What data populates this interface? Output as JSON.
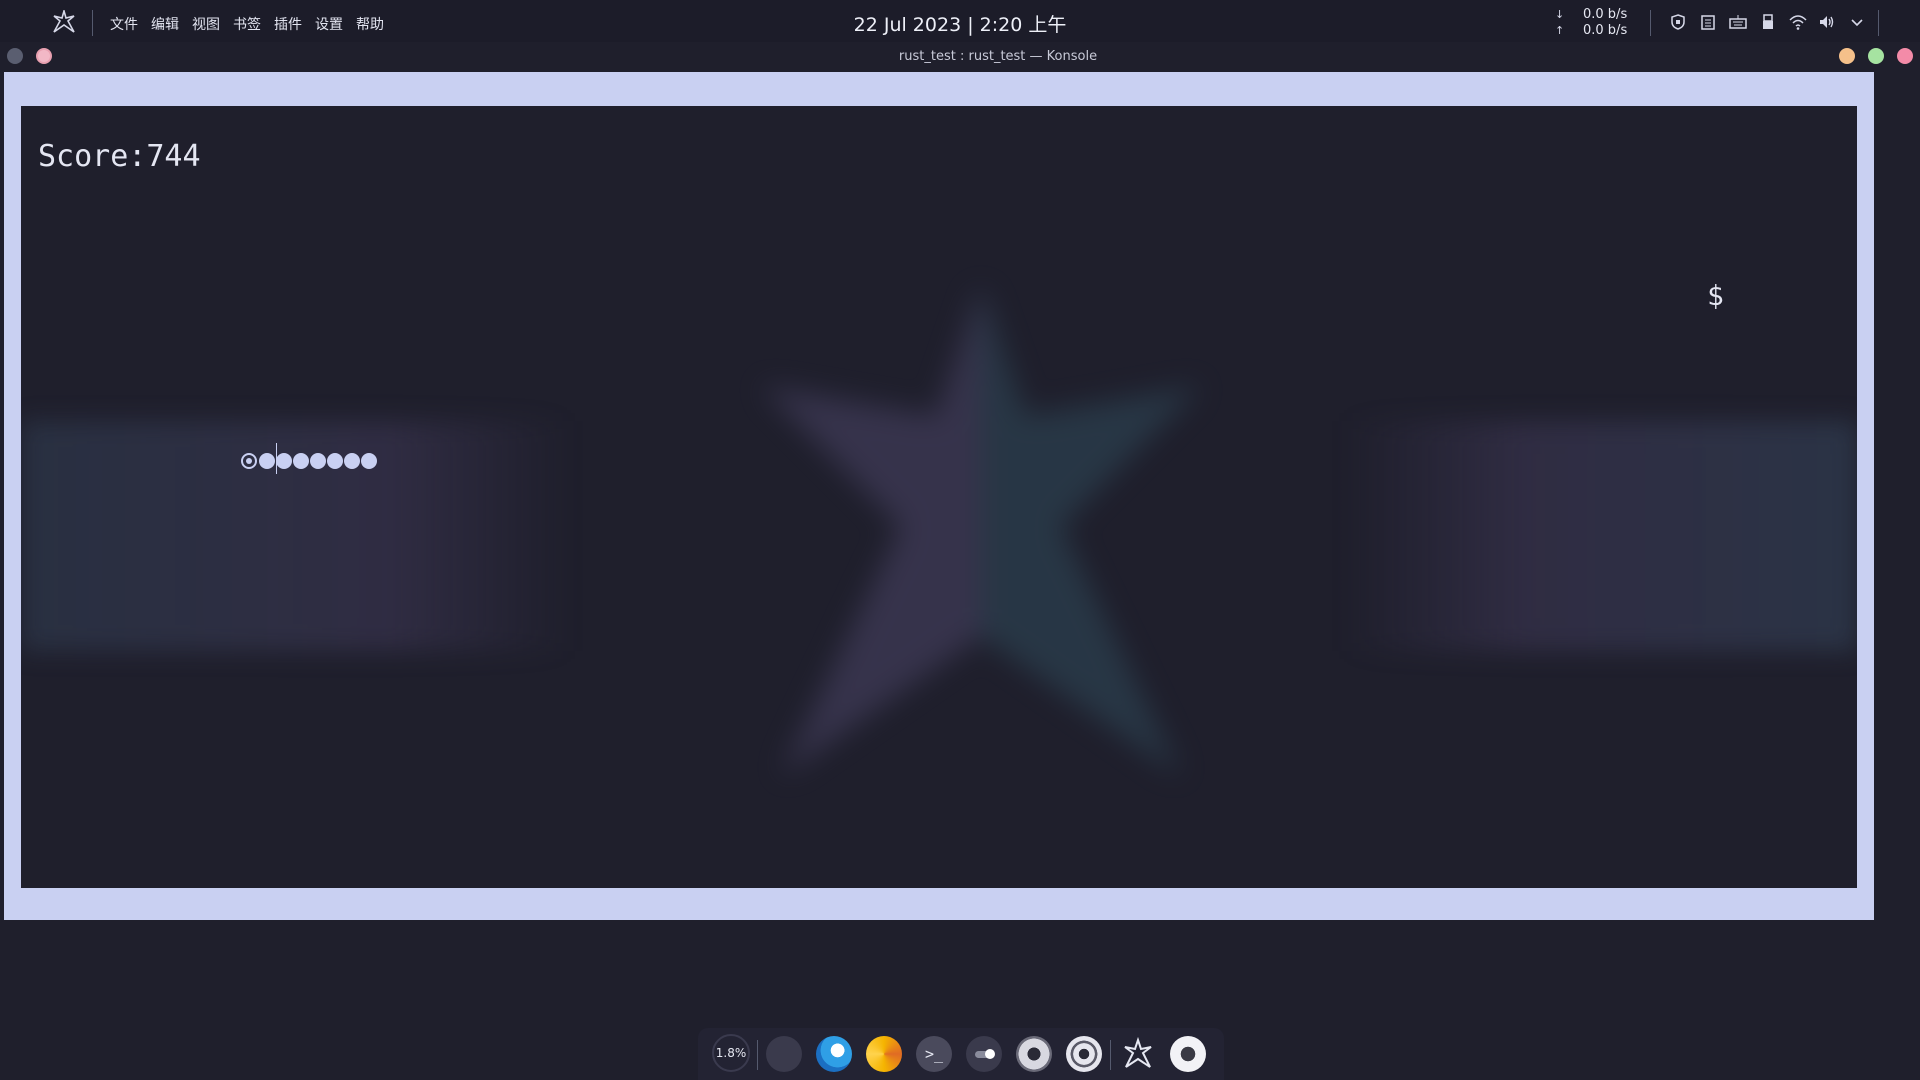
{
  "panel": {
    "menus": [
      "文件",
      "编辑",
      "视图",
      "书签",
      "插件",
      "设置",
      "帮助"
    ],
    "clock": "22 Jul 2023 | 2:20 上午",
    "net_down_arrow": "↓",
    "net_down": "0.0 b/s",
    "net_up_arrow": "↑",
    "net_up": "0.0 b/s",
    "tray_icons": [
      "security-icon",
      "clipboard-icon",
      "keyboard-icon",
      "usb-device-icon",
      "wifi-icon",
      "volume-icon",
      "chevron-down-icon"
    ]
  },
  "window": {
    "title": "rust_test : rust_test — Konsole"
  },
  "game": {
    "score": "Score:744",
    "food": "$",
    "snake_segments": 7
  },
  "dock": {
    "cpu_label": "1.8%",
    "apps": [
      "file-manager-icon",
      "edge-browser-icon",
      "swirl-app-icon",
      "terminal-icon",
      "toggle-settings-icon",
      "disk-utility-icon",
      "media-player-icon",
      "arch-logo-icon",
      "record-button-icon"
    ]
  },
  "colors": {
    "background": "#1f1f2c",
    "frame": "#c9d0f2",
    "text": "#e4e6f2"
  }
}
